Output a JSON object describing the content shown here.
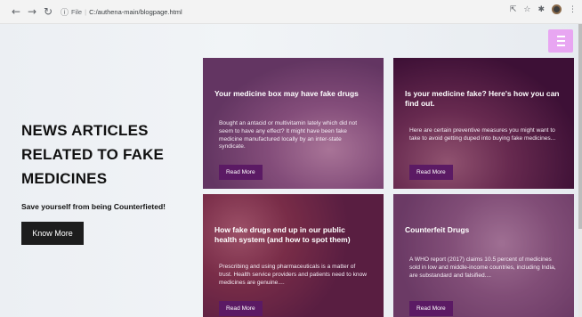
{
  "browser": {
    "back_icon": "arrow-left-icon",
    "forward_icon": "arrow-right-icon",
    "reload_icon": "reload-icon",
    "info_icon": "info-icon",
    "file_label": "File",
    "url": "C:/authena-main/blogpage.html"
  },
  "page": {
    "menu_icon": "hamburger-icon",
    "menu_color": "#e8a6f2",
    "hero": {
      "title": "NEWS ARTICLES RELATED TO FAKE MEDICINES",
      "subtitle": "Save yourself from being Counterfieted!",
      "button_label": "Know More"
    },
    "cards": [
      {
        "title": "Your medicine box may have fake drugs",
        "text": "Bought an antacid or multivitamin lately which did not seem to have any effect? It might have been fake medicine manufactured locally by an inter-state syndicate.",
        "button_label": "Read More"
      },
      {
        "title": "Is your medicine fake? Here's how you can find out.",
        "text": "Here are certain preventive measures you might want to take to avoid getting duped into buying fake medicines...",
        "button_label": "Read More"
      },
      {
        "title": "How fake drugs end up in our public health system (and how to spot them)",
        "text": "Prescribing and using pharmaceuticals is a matter of trust. Health service providers and patients need to know medicines are genuine....",
        "button_label": "Read More"
      },
      {
        "title": "Counterfeit Drugs",
        "text": "A WHO report (2017) claims 10.5 percent of medicines sold in low and middle-income countries, including India, are substandard and falsified....",
        "button_label": "Read More"
      }
    ],
    "accent_button_color": "#5b1a64"
  }
}
